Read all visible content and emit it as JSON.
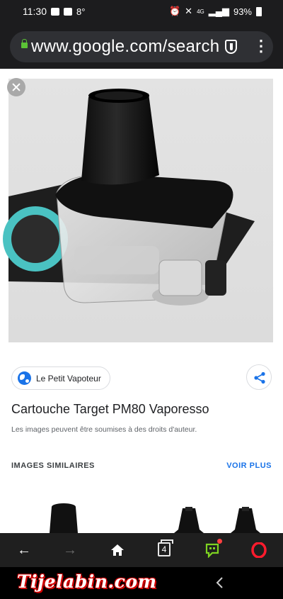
{
  "status_bar": {
    "time": "11:30",
    "temperature": "8°",
    "network": "4G",
    "battery": "93%"
  },
  "browser": {
    "url": "www.google.com/search"
  },
  "source": {
    "name": "Le Petit Vapoteur",
    "icon": "globe-icon"
  },
  "image": {
    "title": "Cartouche Target PM80 Vaporesso",
    "copyright_notice": "Les images peuvent être soumises à des droits d'auteur."
  },
  "similar": {
    "heading": "IMAGES SIMILAIRES",
    "see_more": "VOIR PLUS"
  },
  "nav": {
    "tab_count": "4"
  },
  "watermark": "Tijelabin.com",
  "colors": {
    "link_blue": "#1a73e8",
    "secure_green": "#5bc236",
    "opera_red": "#ff1b2d",
    "bar_dark": "#1f1f1f"
  }
}
